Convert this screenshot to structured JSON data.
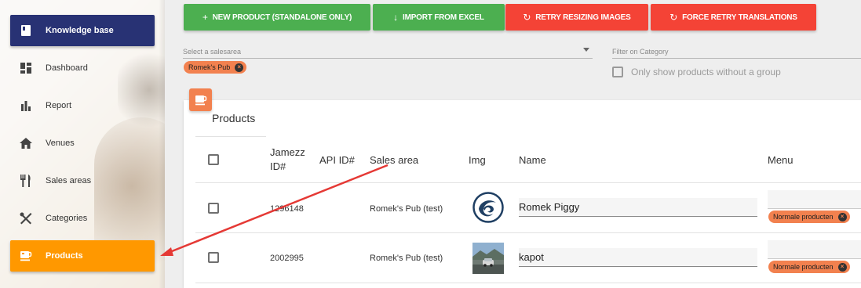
{
  "sidebar": {
    "items": [
      {
        "label": "Knowledge base",
        "icon": "book-icon"
      },
      {
        "label": "Dashboard",
        "icon": "dashboard-icon"
      },
      {
        "label": "Report",
        "icon": "bar-chart-icon"
      },
      {
        "label": "Venues",
        "icon": "home-icon"
      },
      {
        "label": "Sales areas",
        "icon": "cutlery-icon"
      },
      {
        "label": "Categories",
        "icon": "crossed-utensils-icon"
      },
      {
        "label": "Products",
        "icon": "cup-icon"
      }
    ]
  },
  "toolbar": {
    "new_product": "NEW PRODUCT (STANDALONE ONLY)",
    "import_excel": "IMPORT FROM EXCEL",
    "retry_images": "RETRY RESIZING IMAGES",
    "force_translations": "FORCE RETRY TRANSLATIONS"
  },
  "filters": {
    "salesarea_placeholder": "Select a salesarea",
    "salesarea_chip": "Romek's Pub",
    "category_placeholder": "Filter on Category",
    "only_without_group": "Only show products without a group"
  },
  "products": {
    "title": "Products",
    "columns": {
      "jamezz_id_line1": "Jamezz",
      "jamezz_id_line2": "ID#",
      "api_id": "API ID#",
      "sales_area": "Sales area",
      "img": "Img",
      "name": "Name",
      "menu": "Menu"
    },
    "rows": [
      {
        "id": "1296148",
        "sales_area": "Romek's Pub (test)",
        "name": "Romek Piggy",
        "menu_chip": "Normale producten"
      },
      {
        "id": "2002995",
        "sales_area": "Romek's Pub (test)",
        "name": "kapot",
        "menu_chip": "Normale producten"
      }
    ]
  },
  "colors": {
    "kb_bg": "#283274",
    "active_bg": "#ff9800",
    "green": "#4caf50",
    "red": "#f44336",
    "chip": "#f2814f",
    "arrow": "#e53935"
  }
}
